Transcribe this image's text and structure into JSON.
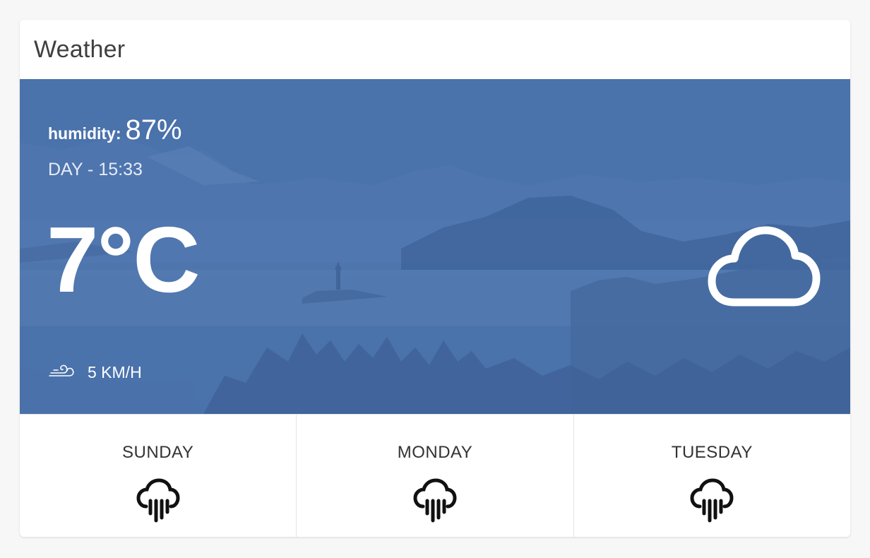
{
  "widget": {
    "title": "Weather"
  },
  "current": {
    "humidity_label": "humidity:",
    "humidity_value": "87%",
    "time": "DAY - 15:33",
    "temperature": "7°C",
    "condition_icon": "cloud-icon",
    "wind_icon": "wind-icon",
    "wind_speed": "5 KM/H"
  },
  "forecast": [
    {
      "day": "SUNDAY",
      "icon": "rain-icon"
    },
    {
      "day": "MONDAY",
      "icon": "rain-icon"
    },
    {
      "day": "TUESDAY",
      "icon": "rain-icon"
    }
  ],
  "colors": {
    "hero_background": "#4a72ab",
    "text_dark": "#333333",
    "text_light": "#ffffff"
  }
}
